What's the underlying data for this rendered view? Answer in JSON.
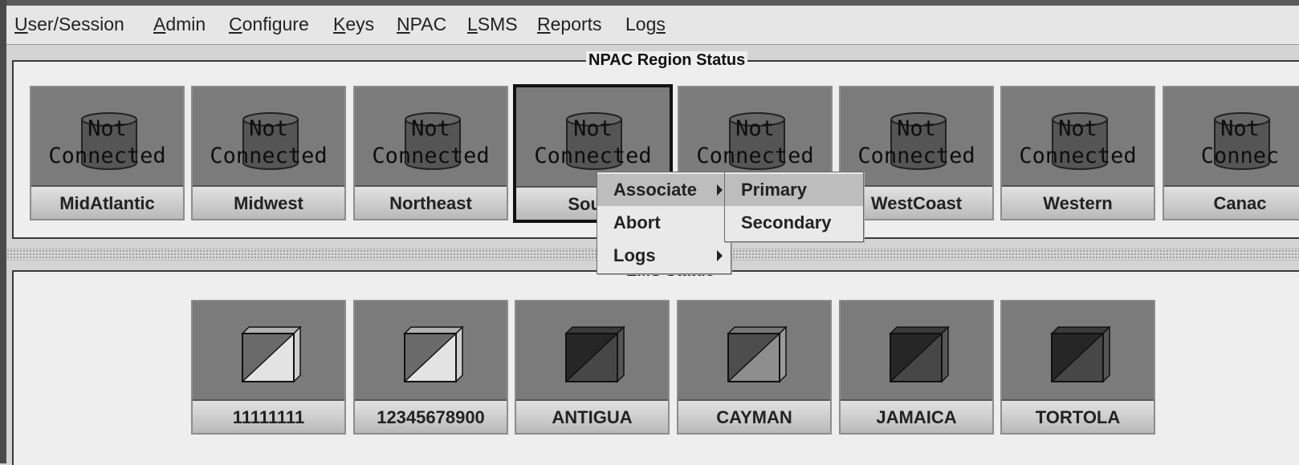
{
  "menubar": {
    "items": [
      {
        "prefix": "",
        "mnemonic": "U",
        "rest": "ser/Session"
      },
      {
        "prefix": "",
        "mnemonic": "A",
        "rest": "dmin"
      },
      {
        "prefix": "",
        "mnemonic": "C",
        "rest": "onfigure"
      },
      {
        "prefix": "",
        "mnemonic": "K",
        "rest": "eys"
      },
      {
        "prefix": "",
        "mnemonic": "N",
        "rest": "PAC"
      },
      {
        "prefix": "",
        "mnemonic": "L",
        "rest": "SMS"
      },
      {
        "prefix": "",
        "mnemonic": "R",
        "rest": "eports"
      },
      {
        "prefix": "Log",
        "mnemonic": "s",
        "rest": ""
      }
    ]
  },
  "npac_panel": {
    "title": "NPAC Region Status",
    "regions": [
      {
        "name": "MidAtlantic",
        "status_line1": "Not",
        "status_line2": "Connected",
        "status_icon": "database-cylinder-icon"
      },
      {
        "name": "Midwest",
        "status_line1": "Not",
        "status_line2": "Connected",
        "status_icon": "database-cylinder-icon"
      },
      {
        "name": "Northeast",
        "status_line1": "Not",
        "status_line2": "Connected",
        "status_icon": "database-cylinder-icon"
      },
      {
        "name": "South",
        "status_line1": "Not",
        "status_line2": "Connected",
        "status_icon": "database-cylinder-icon",
        "selected": true
      },
      {
        "name": "",
        "status_line1": "Not",
        "status_line2": "Connected",
        "status_icon": "database-cylinder-icon"
      },
      {
        "name": "WestCoast",
        "status_line1": "Not",
        "status_line2": "Connected",
        "status_icon": "database-cylinder-icon"
      },
      {
        "name": "Western",
        "status_line1": "Not",
        "status_line2": "Connected",
        "status_icon": "database-cylinder-icon"
      },
      {
        "name": "Canac",
        "status_line1": "Not",
        "status_line2": "Connec",
        "status_icon": "database-cylinder-icon"
      }
    ]
  },
  "ems_panel": {
    "title": "EMS Status",
    "items": [
      {
        "name": "11111111",
        "icon": "server-cube-icon",
        "shade": "light"
      },
      {
        "name": "12345678900",
        "icon": "server-cube-icon",
        "shade": "light"
      },
      {
        "name": "ANTIGUA",
        "icon": "server-cube-icon",
        "shade": "dark"
      },
      {
        "name": "CAYMAN",
        "icon": "server-cube-icon",
        "shade": "medium"
      },
      {
        "name": "JAMAICA",
        "icon": "server-cube-icon",
        "shade": "dark"
      },
      {
        "name": "TORTOLA",
        "icon": "server-cube-icon",
        "shade": "dark"
      }
    ]
  },
  "context_menu": {
    "items": [
      {
        "label": "Associate",
        "has_submenu": true,
        "highlighted": true
      },
      {
        "label": "Abort",
        "has_submenu": false
      },
      {
        "label": "Logs",
        "has_submenu": true
      }
    ],
    "submenu": {
      "items": [
        {
          "label": "Primary",
          "highlighted": true
        },
        {
          "label": "Secondary"
        }
      ]
    }
  },
  "colors": {
    "tile_background": "#7b7b7b",
    "highlight": "#bdbdbd",
    "panel_background": "#eeeeee"
  }
}
